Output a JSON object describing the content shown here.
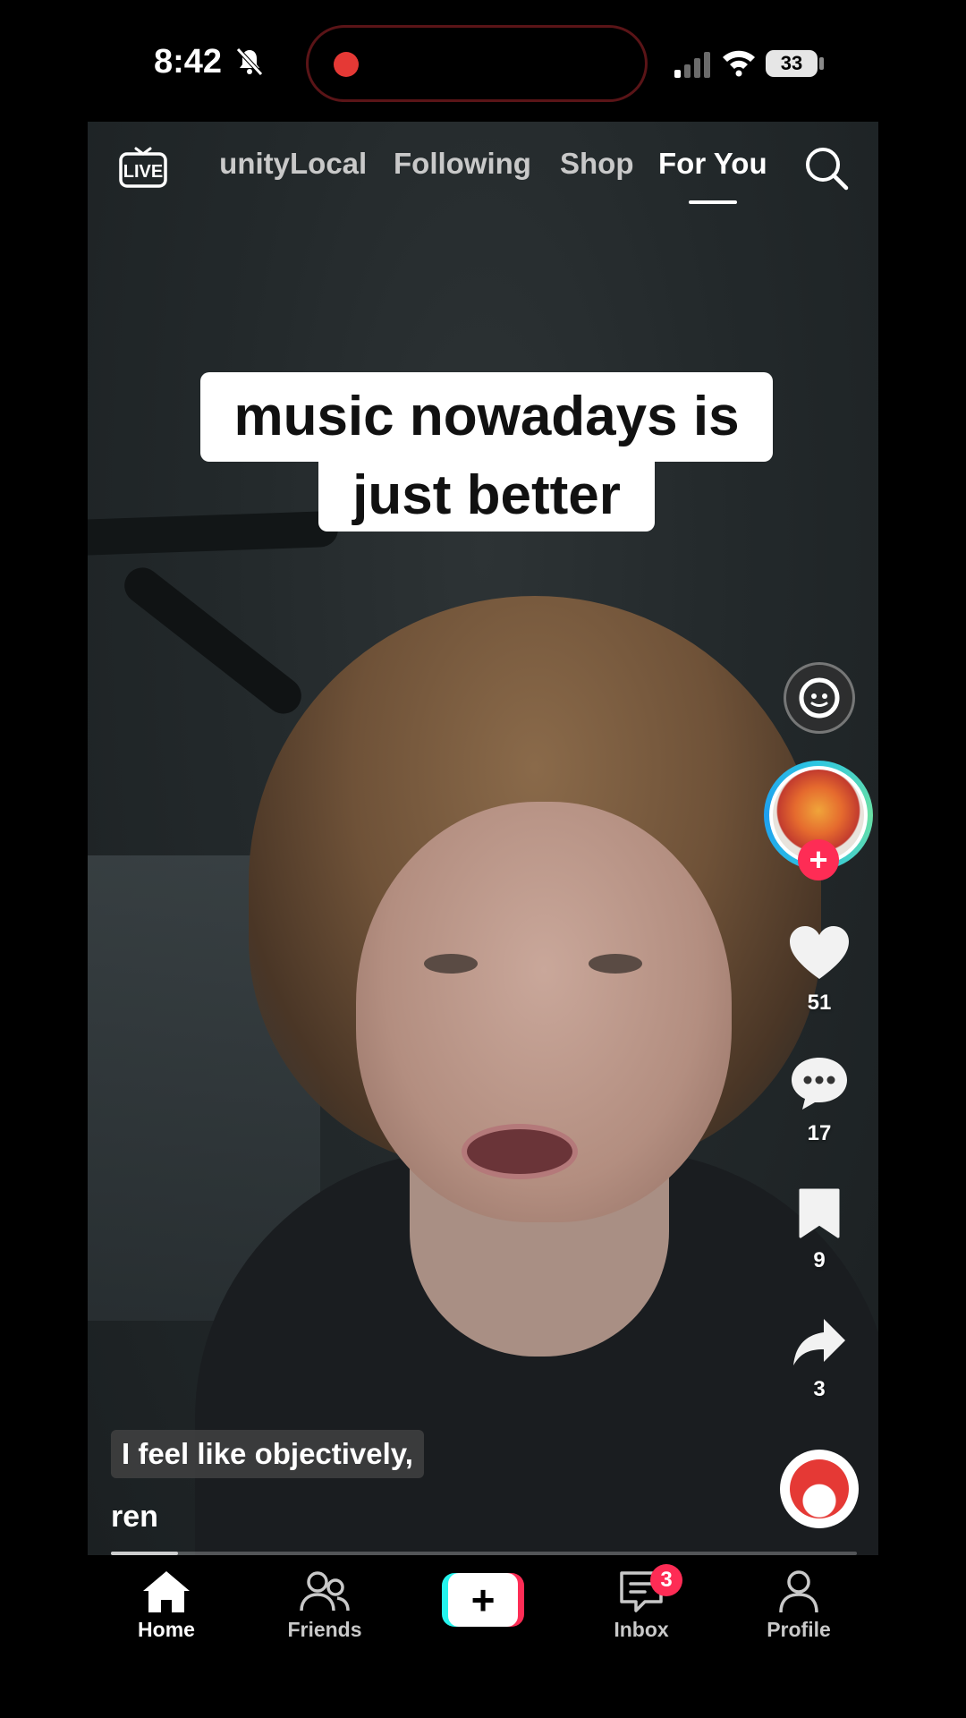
{
  "status_bar": {
    "time": "8:42",
    "battery": "33",
    "icons": [
      "bell-slash-icon",
      "record-dot-icon",
      "signal-icon",
      "wifi-icon",
      "battery-icon"
    ]
  },
  "top_nav": {
    "live_label": "LIVE",
    "tabs": [
      {
        "label": "unity"
      },
      {
        "label": "Local"
      },
      {
        "label": "Following"
      },
      {
        "label": "Shop"
      },
      {
        "label": "For You",
        "active": true
      }
    ]
  },
  "video": {
    "caption_line1": "music nowadays is",
    "caption_line2": "just better",
    "subtitle": "I feel like objectively,",
    "author": "ren",
    "progress": 0.09
  },
  "actions": {
    "likes": "51",
    "comments": "17",
    "saves": "9",
    "shares": "3"
  },
  "bottom_nav": {
    "home": "Home",
    "friends": "Friends",
    "inbox": "Inbox",
    "inbox_badge": "3",
    "profile": "Profile"
  },
  "colors": {
    "accent_red": "#fe2c55",
    "accent_cyan": "#25f4ee"
  }
}
